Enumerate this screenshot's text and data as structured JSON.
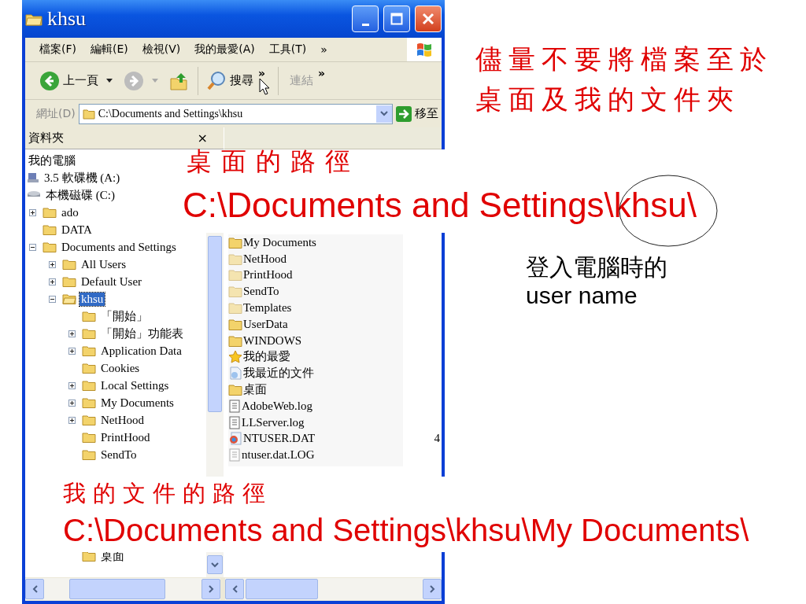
{
  "window": {
    "title": "khsu"
  },
  "menu": [
    "檔案(F)",
    "編輯(E)",
    "檢視(V)",
    "我的最愛(A)",
    "工具(T)",
    "»"
  ],
  "toolbar": {
    "back": "上一頁",
    "search": "搜尋",
    "more": "»",
    "links": "連結",
    "links_more": "»"
  },
  "address": {
    "label": "網址(D)",
    "value": "C:\\Documents and Settings\\khsu",
    "go": "移至"
  },
  "folders_pane": {
    "title": "資料夾",
    "close": "×",
    "tree": [
      {
        "label": "我的電腦",
        "selected": false,
        "children": [
          {
            "label": "3.5 軟碟機 (A:)",
            "kind": "floppy",
            "selected": false
          },
          {
            "label": "本機磁碟 (C:)",
            "kind": "disk",
            "selected": false,
            "children": [
              {
                "label": "ado",
                "kind": "folder",
                "expanded": false,
                "selected": false
              },
              {
                "label": "DATA",
                "kind": "folder",
                "selected": false
              },
              {
                "label": "Documents and Settings",
                "kind": "folder",
                "expanded": true,
                "selected": false,
                "children": [
                  {
                    "label": "All Users",
                    "kind": "folder",
                    "expanded": false,
                    "selected": false
                  },
                  {
                    "label": "Default User",
                    "kind": "folder",
                    "expanded": false,
                    "selected": false
                  },
                  {
                    "label": "khsu",
                    "kind": "open-folder",
                    "expanded": true,
                    "selected": true,
                    "children": [
                      {
                        "label": "「開始」",
                        "kind": "folder",
                        "selected": false
                      },
                      {
                        "label": "「開始」功能表",
                        "kind": "folder",
                        "expanded": false,
                        "selected": false
                      },
                      {
                        "label": "Application Data",
                        "kind": "folder",
                        "expanded": false,
                        "selected": false
                      },
                      {
                        "label": "Cookies",
                        "kind": "folder",
                        "selected": false
                      },
                      {
                        "label": "Local Settings",
                        "kind": "folder",
                        "expanded": false,
                        "selected": false
                      },
                      {
                        "label": "My Documents",
                        "kind": "folder",
                        "expanded": false,
                        "selected": false
                      },
                      {
                        "label": "NetHood",
                        "kind": "folder",
                        "expanded": false,
                        "selected": false
                      },
                      {
                        "label": "PrintHood",
                        "kind": "folder",
                        "selected": false
                      },
                      {
                        "label": "SendTo",
                        "kind": "folder",
                        "selected": false
                      },
                      {
                        "label": "桌面",
                        "kind": "folder",
                        "selected": false
                      }
                    ]
                  }
                ]
              }
            ]
          }
        ]
      }
    ]
  },
  "file_list": {
    "items": [
      {
        "name": "My Documents",
        "kind": "folder"
      },
      {
        "name": "NetHood",
        "kind": "hidden-folder"
      },
      {
        "name": "PrintHood",
        "kind": "hidden-folder"
      },
      {
        "name": "SendTo",
        "kind": "hidden-folder"
      },
      {
        "name": "Templates",
        "kind": "hidden-folder"
      },
      {
        "name": "UserData",
        "kind": "folder"
      },
      {
        "name": "WINDOWS",
        "kind": "folder"
      },
      {
        "name": "我的最愛",
        "kind": "favorites"
      },
      {
        "name": "我最近的文件",
        "kind": "recent"
      },
      {
        "name": "桌面",
        "kind": "folder"
      },
      {
        "name": "AdobeWeb.log",
        "kind": "text"
      },
      {
        "name": "LLServer.log",
        "kind": "text"
      },
      {
        "name": "NTUSER.DAT",
        "kind": "system",
        "size": "4"
      },
      {
        "name": "ntuser.dat.LOG",
        "kind": "hidden-text"
      }
    ]
  },
  "callouts": {
    "desktop": {
      "title": "桌面的路徑",
      "path": "C:\\Documents and Settings\\khsu\\"
    },
    "documents": {
      "title": "我的文件的路徑",
      "path": "C:\\Documents and Settings\\khsu\\My Documents\\"
    },
    "advice": "儘量不要將檔案至於桌面及我的文件夾",
    "username_note": "登入電腦時的 user name"
  }
}
